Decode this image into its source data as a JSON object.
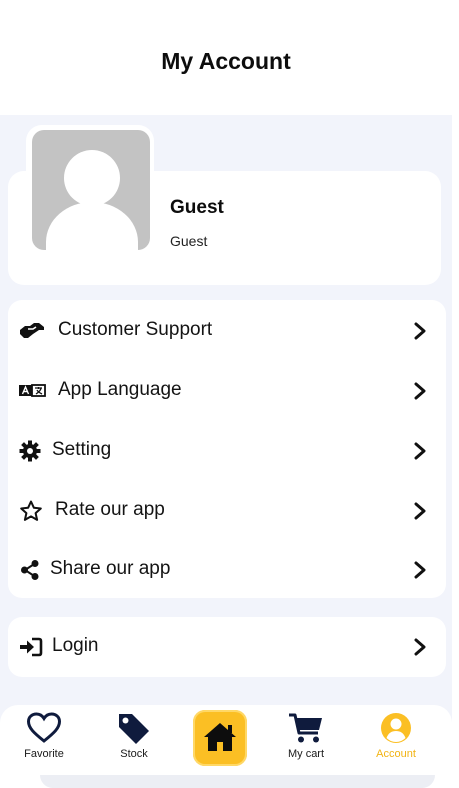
{
  "header": {
    "title": "My Account"
  },
  "profile": {
    "name": "Guest",
    "role": "Guest"
  },
  "menu": {
    "items": [
      {
        "label": "Customer Support",
        "icon": "handshake-icon"
      },
      {
        "label": "App Language",
        "icon": "translate-icon"
      },
      {
        "label": "Setting",
        "icon": "gear-icon"
      },
      {
        "label": "Rate our app",
        "icon": "star-icon"
      },
      {
        "label": "Share our app",
        "icon": "share-icon"
      }
    ],
    "login": {
      "label": "Login",
      "icon": "sign-in-icon"
    }
  },
  "bottom_nav": {
    "items": [
      {
        "label": "Favorite",
        "icon": "heart-icon"
      },
      {
        "label": "Stock",
        "icon": "tag-icon"
      },
      {
        "label": "",
        "icon": "home-icon"
      },
      {
        "label": "My cart",
        "icon": "cart-icon"
      },
      {
        "label": "Account",
        "icon": "user-circle-icon"
      }
    ],
    "active": "Account"
  },
  "colors": {
    "accent": "#fbbf24",
    "active_label": "#f2b414",
    "background": "#f2f4fb",
    "icon_dark": "#0f1b3d"
  }
}
